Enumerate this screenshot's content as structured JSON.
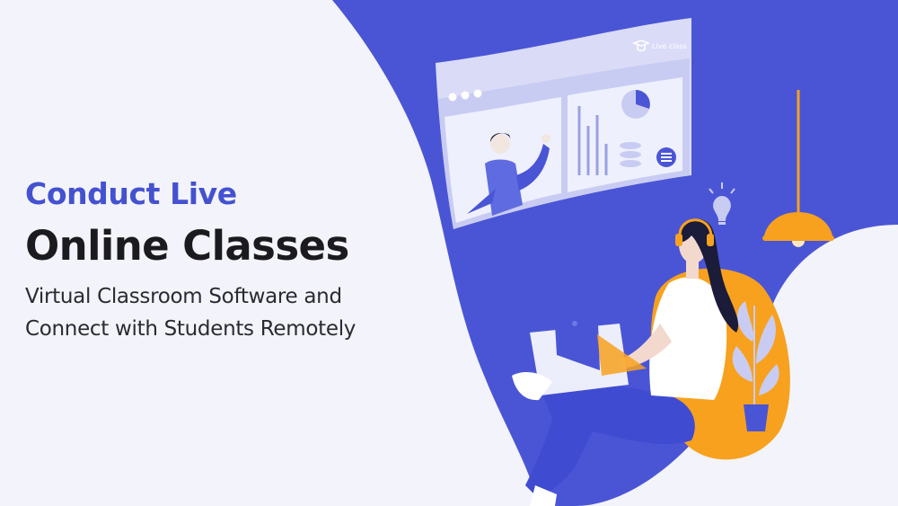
{
  "hero": {
    "kicker": "Conduct Live",
    "headline": "Online Classes",
    "subtitle_line1": "Virtual Classroom Software and",
    "subtitle_line2": "Connect with Students Remotely"
  },
  "illustration": {
    "window_label": "Live class",
    "icons": [
      "live-class-icon",
      "menu-list-icon",
      "lightbulb-icon",
      "pendant-lamp-icon",
      "headphones-icon",
      "laptop-icon",
      "potted-plant-icon"
    ]
  },
  "colors": {
    "background": "#f3f3fb",
    "accent_blue": "#4a55d6",
    "heading_text": "#1b1b1f",
    "kicker_blue": "#4452d0",
    "orange": "#f7a11e",
    "window_lavender": "#c9ccf2"
  }
}
